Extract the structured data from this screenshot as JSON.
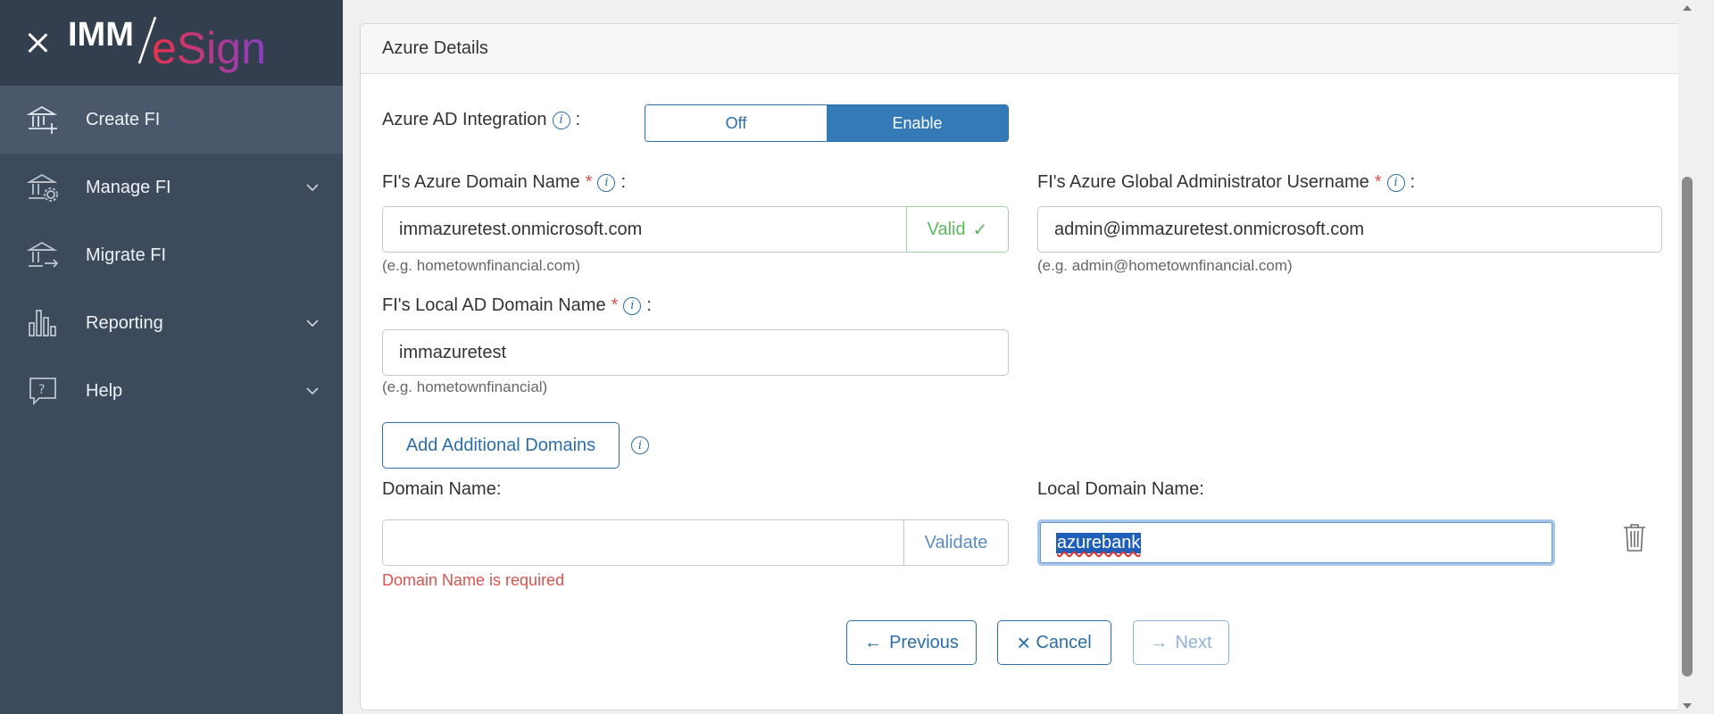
{
  "brand": {
    "name_prefix": "IMM",
    "name_suffix": "eSign"
  },
  "sidebar": {
    "items": [
      {
        "label": "Create FI",
        "icon": "bank-add-icon",
        "active": true,
        "has_chevron": false
      },
      {
        "label": "Manage FI",
        "icon": "bank-gear-icon",
        "active": false,
        "has_chevron": true
      },
      {
        "label": "Migrate FI",
        "icon": "bank-arrow-icon",
        "active": false,
        "has_chevron": false
      },
      {
        "label": "Reporting",
        "icon": "bar-chart-icon",
        "active": false,
        "has_chevron": true
      },
      {
        "label": "Help",
        "icon": "help-bubble-icon",
        "active": false,
        "has_chevron": true
      }
    ]
  },
  "card": {
    "title": "Azure Details"
  },
  "azure_ad": {
    "label": "Azure AD Integration",
    "colon": ":",
    "off_label": "Off",
    "enable_label": "Enable",
    "selected": "Enable"
  },
  "azure_domain": {
    "label": "FI's Azure Domain Name",
    "required_mark": "*",
    "colon": ":",
    "value": "immazuretest.onmicrosoft.com",
    "status": "Valid",
    "status_mark": "✓",
    "hint": "(e.g. hometownfinancial.com)"
  },
  "global_admin": {
    "label": "FI's Azure Global Administrator Username",
    "required_mark": "*",
    "colon": ":",
    "value": "admin@immazuretest.onmicrosoft.com",
    "hint": "(e.g. admin@hometownfinancial.com)"
  },
  "local_ad": {
    "label": "FI's Local AD Domain Name",
    "required_mark": "*",
    "colon": ":",
    "value": "immazuretest",
    "hint": "(e.g. hometownfinancial)"
  },
  "add_domains": {
    "label": "Add Additional Domains"
  },
  "extra_domain": {
    "domain_label": "Domain Name:",
    "domain_value": "",
    "validate_label": "Validate",
    "error": "Domain Name is required",
    "local_label": "Local Domain Name:",
    "local_value": "azurebank"
  },
  "footer": {
    "previous": "Previous",
    "cancel": "Cancel",
    "next": "Next"
  },
  "colors": {
    "sidebar_bg": "#3d4a5c",
    "accent": "#337ab7",
    "valid": "#5cb85c",
    "error": "#d9534f"
  }
}
